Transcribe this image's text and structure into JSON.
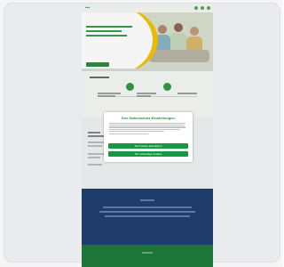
{
  "modal": {
    "title": "Ihre Datenschutz-Einstellungen",
    "body": "",
    "accept_all_label": "Alle Cookies akzeptieren",
    "necessary_only_label": "Nur notwendige Cookies"
  },
  "colors": {
    "brand_green": "#2e8b3c",
    "accent_yellow": "#f2c200",
    "navy": "#223f6f"
  }
}
